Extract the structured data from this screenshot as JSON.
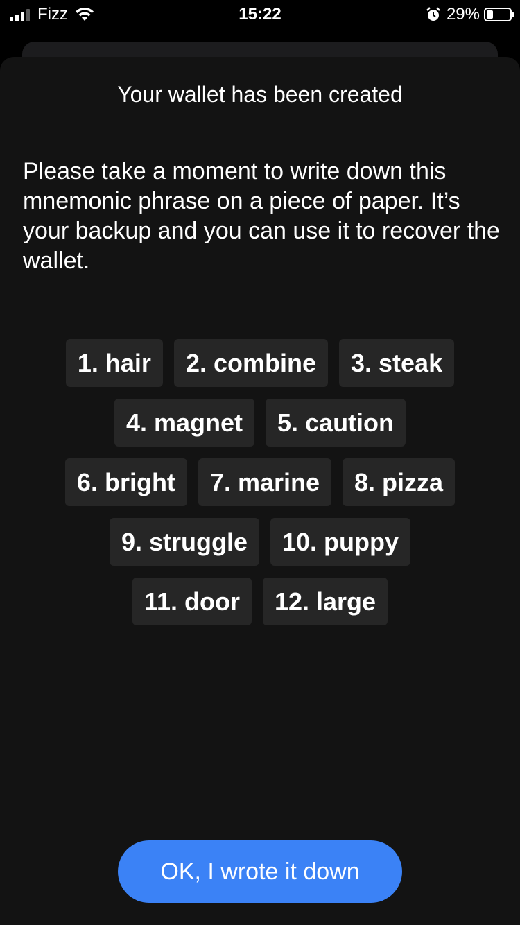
{
  "status_bar": {
    "carrier": "Fizz",
    "time": "15:22",
    "battery_percent": "29%",
    "battery_level": 0.29,
    "icons": [
      "signal-icon",
      "wifi-icon",
      "alarm-icon",
      "battery-icon"
    ]
  },
  "sheet": {
    "title": "Your wallet has been created",
    "instructions": "Please take a moment to write down this mnemonic phrase on a piece of paper. It’s your backup and you can use it to recover the wallet.",
    "words": [
      "1. hair",
      "2. combine",
      "3. steak",
      "4. magnet",
      "5. caution",
      "6. bright",
      "7. marine",
      "8. pizza",
      "9. struggle",
      "10. puppy",
      "11. door",
      "12. large"
    ],
    "confirm_button": "OK, I wrote it down"
  },
  "colors": {
    "background": "#000000",
    "sheet": "#131313",
    "chip": "#262626",
    "accent": "#3b82f6",
    "text": "#ffffff"
  }
}
